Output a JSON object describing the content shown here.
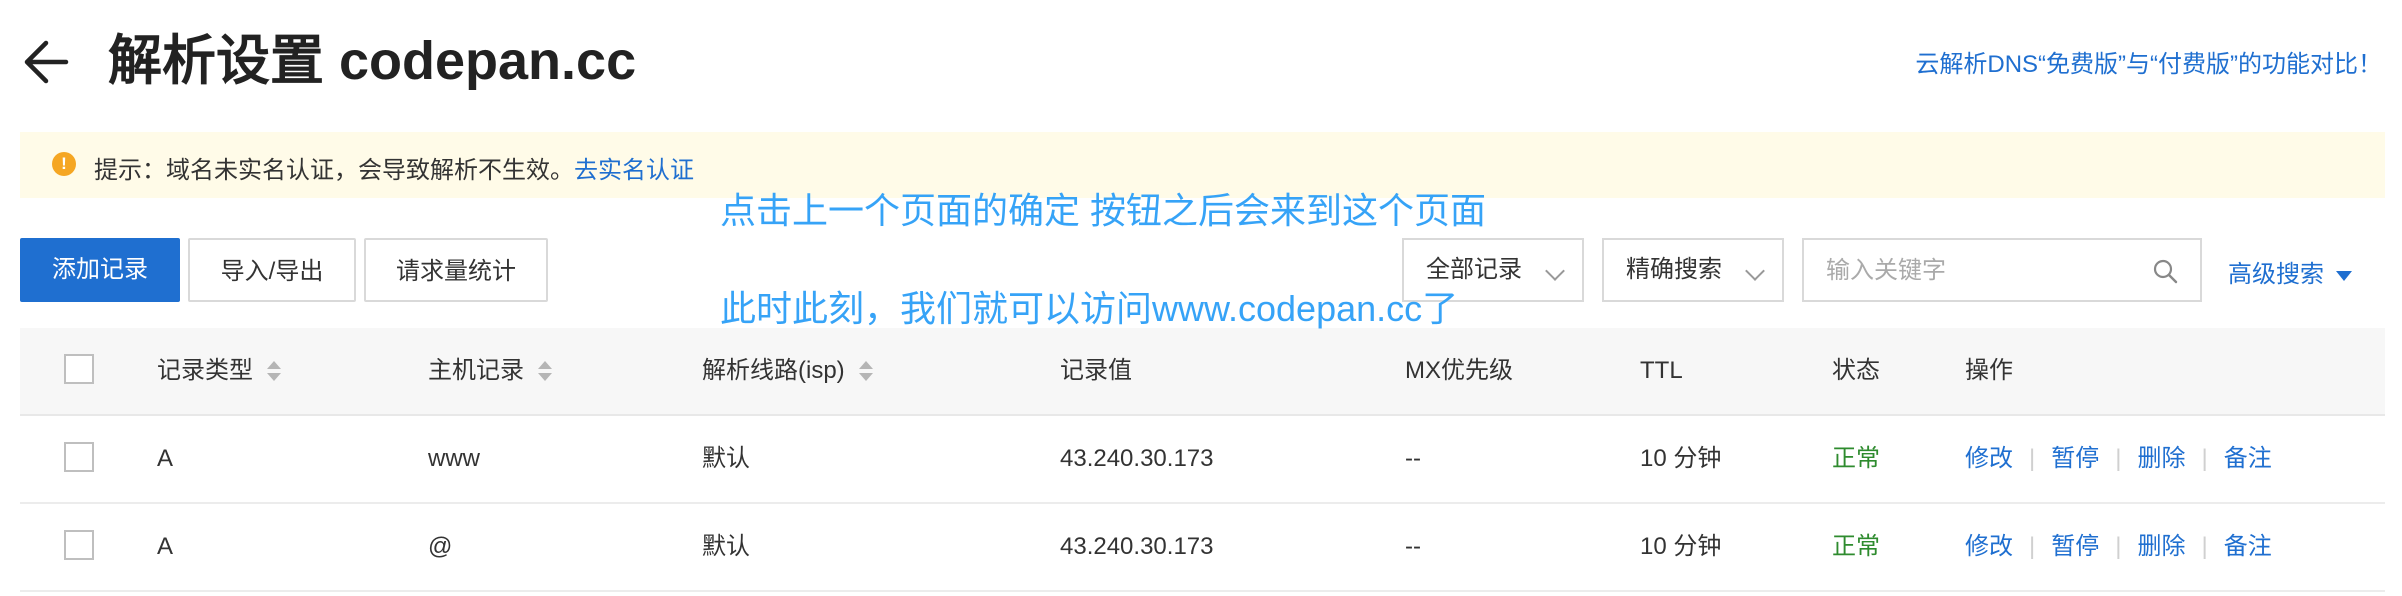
{
  "header": {
    "title": "解析设置 codepan.cc",
    "compare_link": "云解析DNS“免费版”与“付费版”的功能对比！"
  },
  "notice": {
    "icon": "!",
    "text": "提示：域名未实名认证，会导致解析不生效。",
    "link": "去实名认证"
  },
  "annotations": {
    "line1": "点击上一个页面的确定 按钮之后会来到这个页面",
    "line2": "此时此刻，我们就可以访问www.codepan.cc了"
  },
  "toolbar": {
    "add_record": "添加记录",
    "import_export": "导入/导出",
    "request_stats": "请求量统计",
    "record_filter": "全部记录",
    "search_mode": "精确搜索",
    "search_placeholder": "输入关键字",
    "advanced_search": "高级搜索"
  },
  "table": {
    "columns": {
      "type": "记录类型",
      "host": "主机记录",
      "line": "解析线路(isp)",
      "value": "记录值",
      "mx": "MX优先级",
      "ttl": "TTL",
      "status": "状态",
      "ops": "操作"
    },
    "rows": [
      {
        "type": "A",
        "host": "www",
        "line": "默认",
        "value": "43.240.30.173",
        "mx": "--",
        "ttl": "10 分钟",
        "status": "正常"
      },
      {
        "type": "A",
        "host": "@",
        "line": "默认",
        "value": "43.240.30.173",
        "mx": "--",
        "ttl": "10 分钟",
        "status": "正常"
      }
    ],
    "actions": {
      "edit": "修改",
      "pause": "暂停",
      "delete": "删除",
      "note": "备注"
    }
  },
  "colors": {
    "primary": "#1f6fd0",
    "status_ok": "#2e8b2e",
    "notice_bg": "#fffbe8",
    "notice_icon": "#f5a623",
    "annotation": "#36a3f7"
  }
}
